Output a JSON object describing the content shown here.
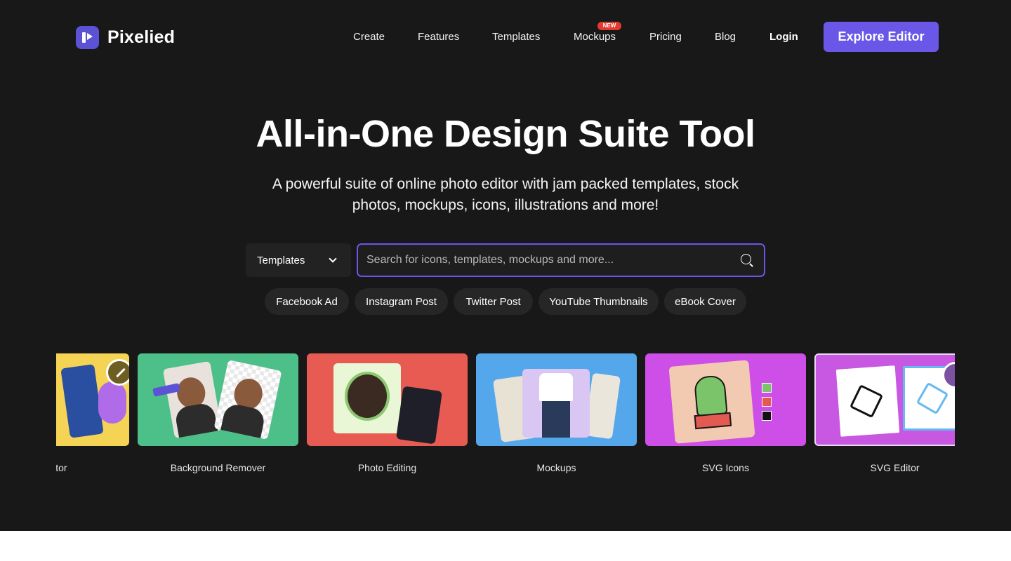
{
  "brand": {
    "name": "Pixelied"
  },
  "nav": {
    "items": [
      "Create",
      "Features",
      "Templates",
      "Mockups",
      "Pricing",
      "Blog"
    ],
    "new_badge": "NEW",
    "login": "Login",
    "cta": "Explore Editor"
  },
  "hero": {
    "title": "All-in-One Design Suite Tool",
    "subtitle": "A powerful suite of online photo editor with jam packed templates, stock photos, mockups, icons, illustrations and more!"
  },
  "search": {
    "type_selected": "Templates",
    "placeholder": "Search for icons, templates, mockups and more..."
  },
  "chips": [
    "Facebook Ad",
    "Instagram Post",
    "Twitter Post",
    "YouTube Thumbnails",
    "eBook Cover"
  ],
  "cards": [
    {
      "label": "enerator",
      "bg": "#f5d354",
      "icon": "magic-wand-icon"
    },
    {
      "label": "Background Remover",
      "bg": "#4dc08a",
      "icon": "background-remover-preview"
    },
    {
      "label": "Photo Editing",
      "bg": "#e85b52",
      "icon": "photo-editing-preview"
    },
    {
      "label": "Mockups",
      "bg": "#55a7ec",
      "icon": "tshirt-mockup-preview"
    },
    {
      "label": "SVG Icons",
      "bg": "#cd4fe8",
      "icon": "cactus-icon-preview"
    },
    {
      "label": "SVG Editor",
      "bg": "#c857e2",
      "icon": "cube-icon-preview"
    }
  ],
  "colors": {
    "accent": "#6a57e8",
    "background": "#181818",
    "badge": "#e23b2e"
  }
}
